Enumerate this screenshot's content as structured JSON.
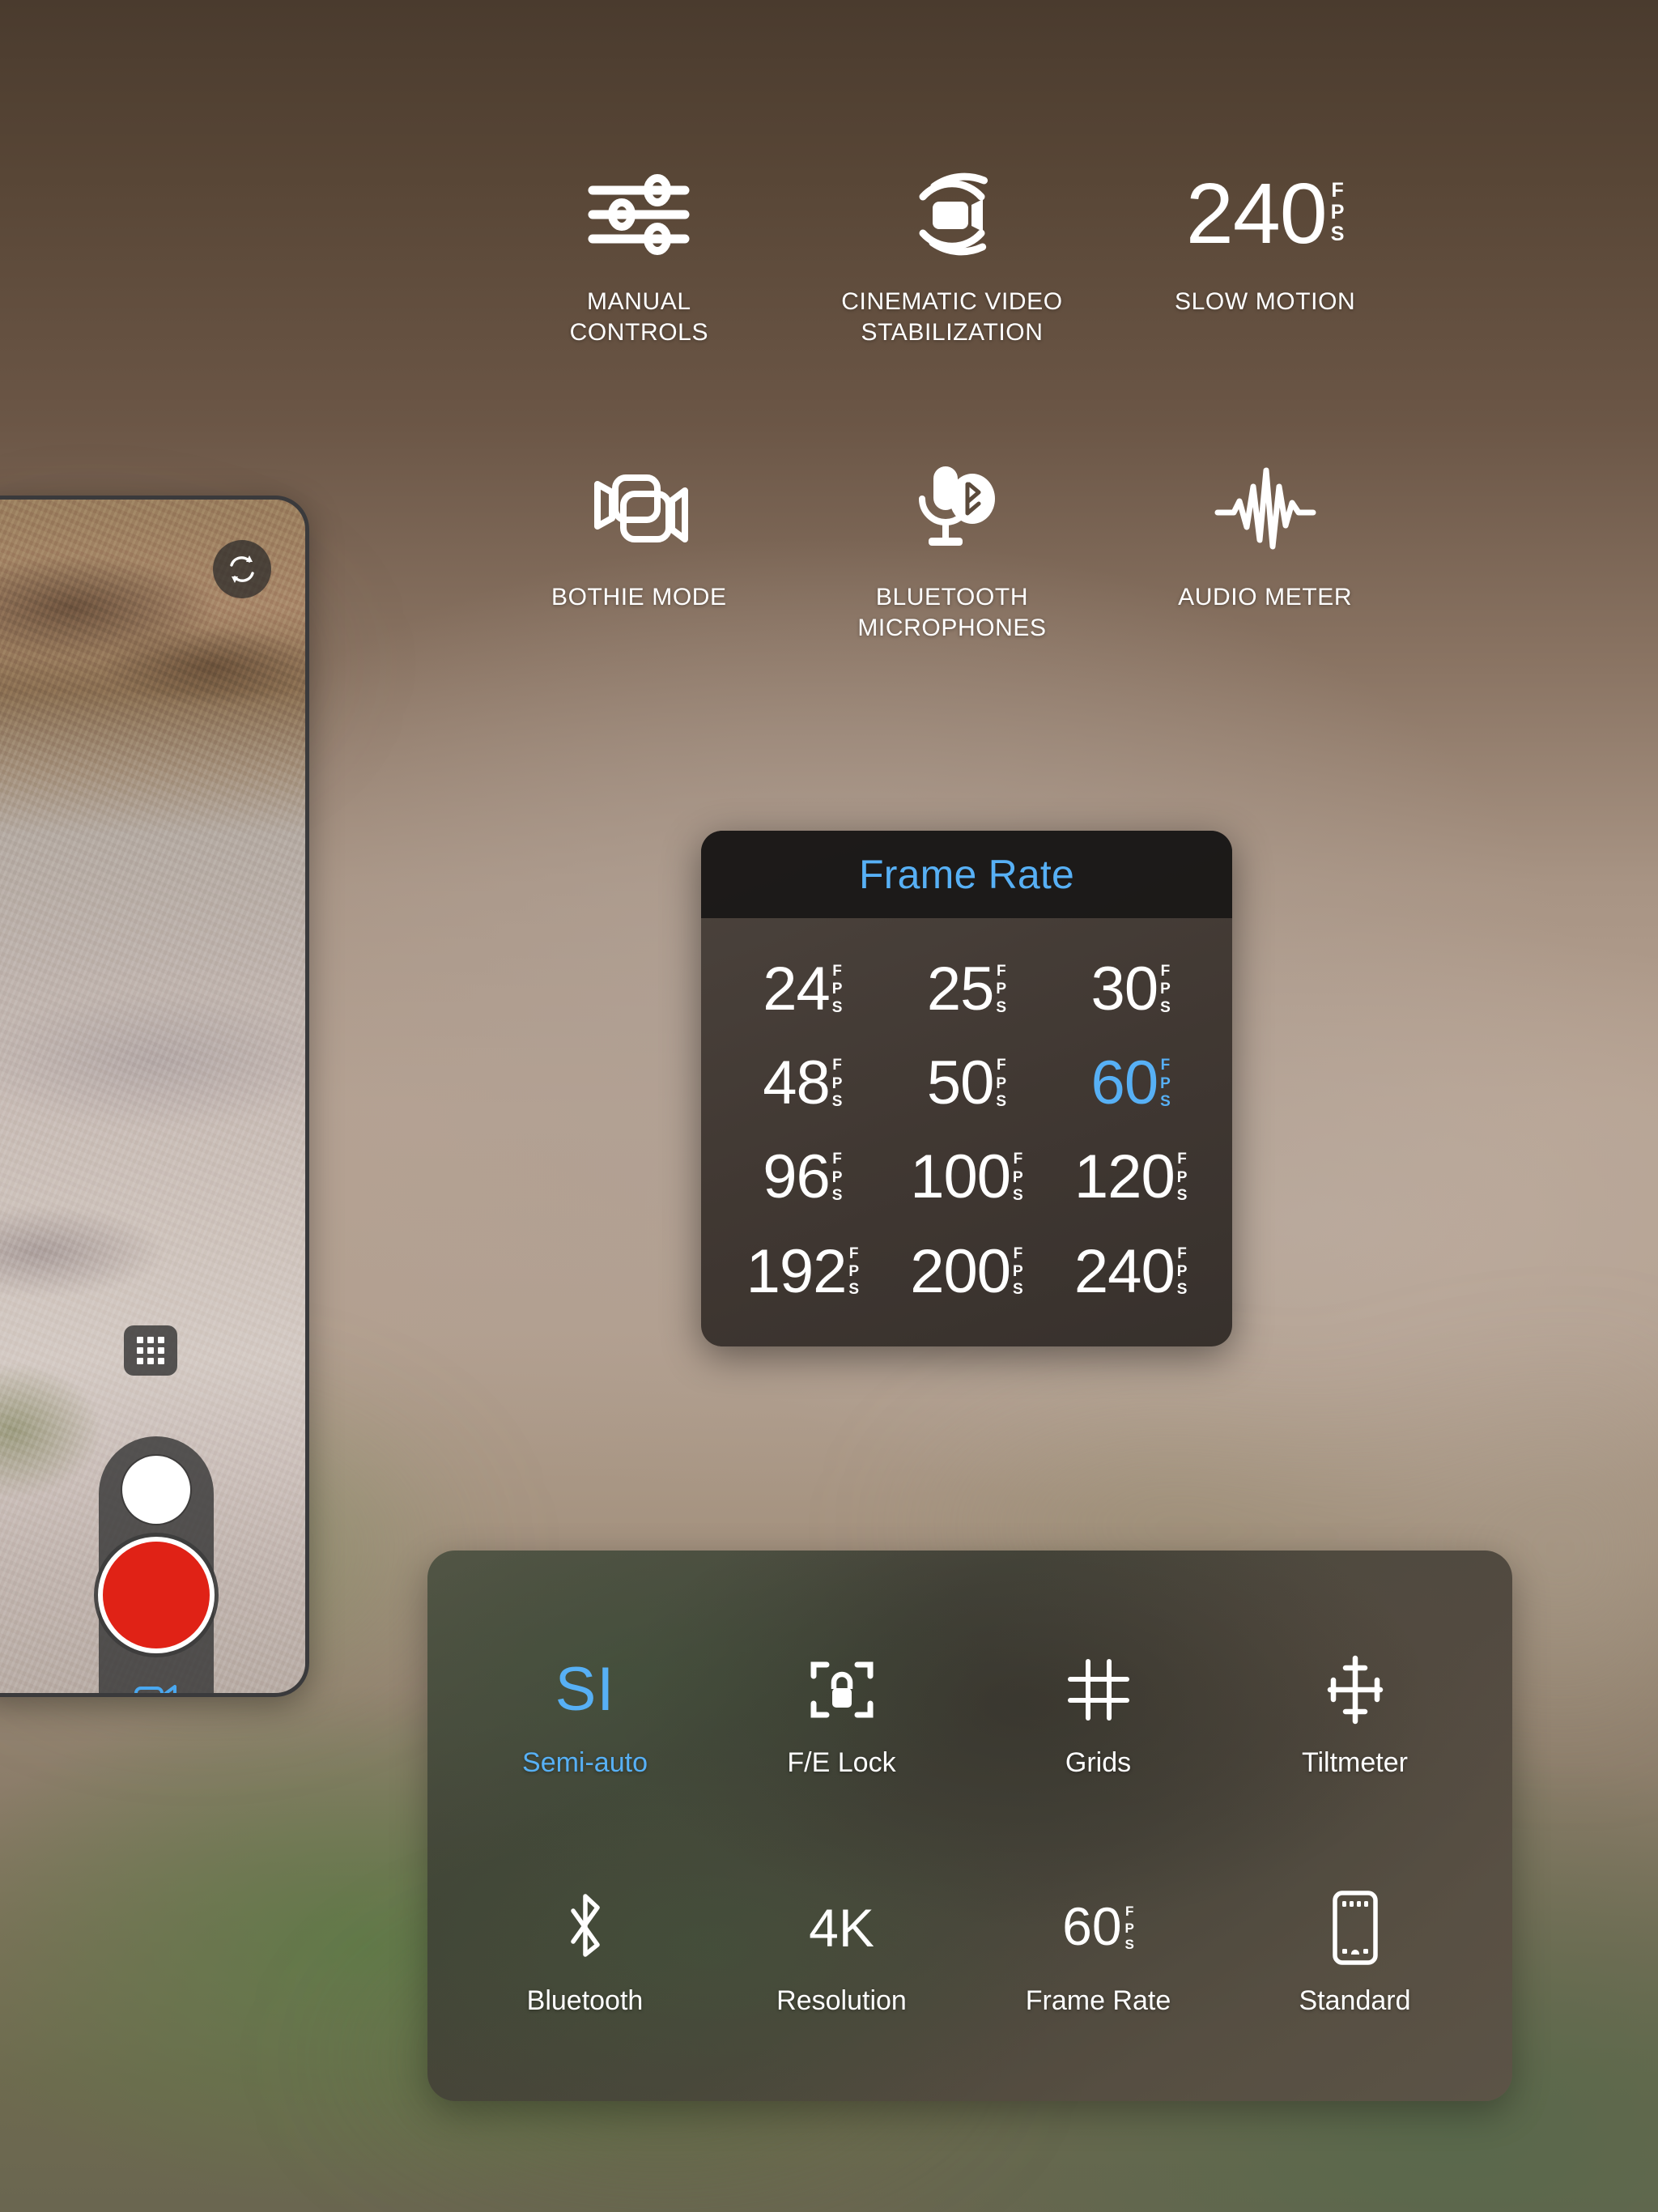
{
  "features": [
    {
      "label": "MANUAL\nCONTROLS",
      "icon": "sliders-icon",
      "name": "feature-manual-controls"
    },
    {
      "label": "CINEMATIC VIDEO\nSTABILIZATION",
      "icon": "video-stabilization-icon",
      "name": "feature-cinematic-video-stabilization"
    },
    {
      "label": "SLOW MOTION",
      "icon": "fps-240-icon",
      "value": "240",
      "unit": [
        "F",
        "P",
        "S"
      ],
      "name": "feature-slow-motion"
    },
    {
      "label": "BOTHIE MODE",
      "icon": "dual-camcorder-icon",
      "name": "feature-bothie-mode"
    },
    {
      "label": "BLUETOOTH\nMICROPHONES",
      "icon": "bluetooth-microphone-icon",
      "name": "feature-bluetooth-microphones"
    },
    {
      "label": "AUDIO METER",
      "icon": "waveform-icon",
      "name": "feature-audio-meter"
    }
  ],
  "phone_preview": {
    "flip_camera_icon": "camera-flip-icon",
    "grid_toggle_icon": "dot-grid-icon",
    "photo_shutter_icon": "photo-shutter-icon",
    "record_icon": "record-icon",
    "video_mode_icon": "camcorder-icon",
    "gallery_thumbnail_icon": "lighthouse-thumbnail"
  },
  "frame_rate_popup": {
    "title": "Frame Rate",
    "title_color": "#57b0f5",
    "selected": "60",
    "unit": [
      "F",
      "P",
      "S"
    ],
    "options": [
      {
        "value": "24",
        "selected": false
      },
      {
        "value": "25",
        "selected": false
      },
      {
        "value": "30",
        "selected": false
      },
      {
        "value": "48",
        "selected": false
      },
      {
        "value": "50",
        "selected": false
      },
      {
        "value": "60",
        "selected": true
      },
      {
        "value": "96",
        "selected": false
      },
      {
        "value": "100",
        "selected": false
      },
      {
        "value": "120",
        "selected": false
      },
      {
        "value": "192",
        "selected": false
      },
      {
        "value": "200",
        "selected": false
      },
      {
        "value": "240",
        "selected": false
      }
    ]
  },
  "control_bar": {
    "items": [
      {
        "label": "Semi-auto",
        "glyph": "SI",
        "icon": "semi-auto-icon",
        "accent": true,
        "name": "control-semi-auto"
      },
      {
        "label": "F/E Lock",
        "glyph": "",
        "icon": "focus-exposure-lock-icon",
        "accent": false,
        "name": "control-fe-lock"
      },
      {
        "label": "Grids",
        "glyph": "",
        "icon": "grid-icon",
        "accent": false,
        "name": "control-grids"
      },
      {
        "label": "Tiltmeter",
        "glyph": "",
        "icon": "tiltmeter-icon",
        "accent": false,
        "name": "control-tiltmeter"
      },
      {
        "label": "Bluetooth",
        "glyph": "",
        "icon": "bluetooth-icon",
        "accent": false,
        "name": "control-bluetooth"
      },
      {
        "label": "Resolution",
        "glyph": "4K",
        "icon": "resolution-icon",
        "accent": false,
        "name": "control-resolution"
      },
      {
        "label": "Frame Rate",
        "glyph": "60",
        "icon": "frame-rate-icon",
        "accent": false,
        "name": "control-frame-rate",
        "unit": [
          "F",
          "P",
          "S"
        ]
      },
      {
        "label": "Standard",
        "glyph": "",
        "icon": "standard-format-icon",
        "accent": false,
        "name": "control-standard"
      }
    ]
  },
  "colors": {
    "accent_blue": "#57b0f5",
    "record_red": "#e02216",
    "panel_dark": "#3a322d",
    "header_dark": "#1a1817"
  }
}
